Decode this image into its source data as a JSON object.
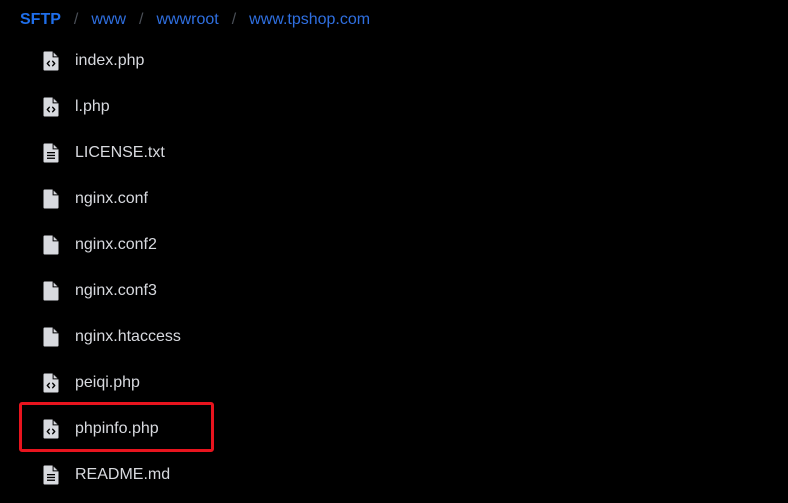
{
  "breadcrumb": {
    "root": "SFTP",
    "separator": "/",
    "items": [
      "www",
      "wwwroot",
      "www.tpshop.com"
    ]
  },
  "files": [
    {
      "name": "index.php",
      "icon": "code-file-icon"
    },
    {
      "name": "l.php",
      "icon": "code-file-icon"
    },
    {
      "name": "LICENSE.txt",
      "icon": "text-file-icon"
    },
    {
      "name": "nginx.conf",
      "icon": "blank-file-icon"
    },
    {
      "name": "nginx.conf2",
      "icon": "blank-file-icon"
    },
    {
      "name": "nginx.conf3",
      "icon": "blank-file-icon"
    },
    {
      "name": "nginx.htaccess",
      "icon": "blank-file-icon"
    },
    {
      "name": "peiqi.php",
      "icon": "code-file-icon"
    },
    {
      "name": "phpinfo.php",
      "icon": "code-file-icon"
    },
    {
      "name": "README.md",
      "icon": "text-file-icon"
    }
  ],
  "colors": {
    "background": "#000000",
    "breadcrumb_root": "#1f6feb",
    "breadcrumb_link": "#2f6fe0",
    "file_text": "#d8dadf",
    "icon": "#d8dadf",
    "highlight": "#e8141e"
  }
}
